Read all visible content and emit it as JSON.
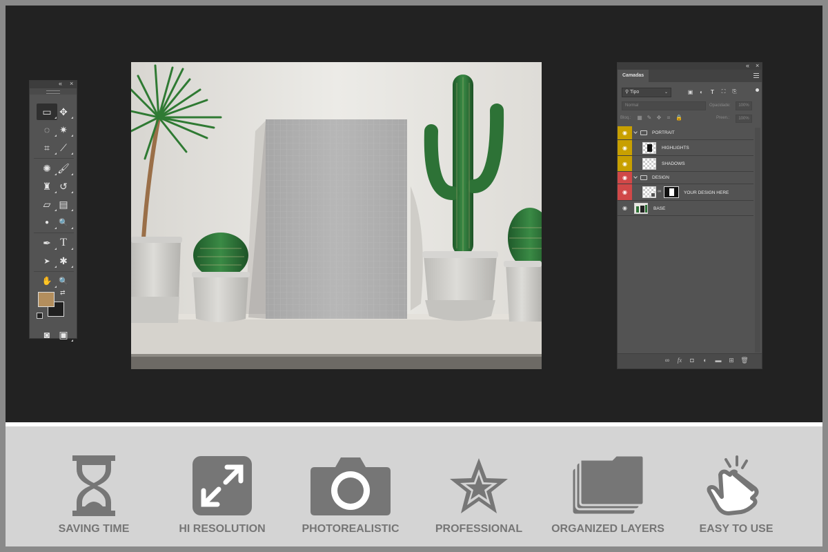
{
  "tools_panel": {
    "collapse_glyph": "«",
    "close_glyph": "×",
    "tools": [
      {
        "name": "rectangular-marquee-icon",
        "glyph": "▭"
      },
      {
        "name": "move-icon",
        "glyph": "✥"
      },
      {
        "name": "lasso-icon",
        "glyph": "◌"
      },
      {
        "name": "magic-wand-icon",
        "glyph": "✷"
      },
      {
        "name": "crop-icon",
        "glyph": "⌗"
      },
      {
        "name": "eyedropper-icon",
        "glyph": "⟋"
      },
      {
        "name": "spot-healing-icon",
        "glyph": "✺"
      },
      {
        "name": "brush-icon",
        "glyph": "🖌"
      },
      {
        "name": "clone-stamp-icon",
        "glyph": "♜"
      },
      {
        "name": "history-brush-icon",
        "glyph": "↺"
      },
      {
        "name": "eraser-icon",
        "glyph": "▱"
      },
      {
        "name": "gradient-icon",
        "glyph": "▤"
      },
      {
        "name": "blur-icon",
        "glyph": "●"
      },
      {
        "name": "dodge-icon",
        "glyph": "🔍"
      },
      {
        "name": "pen-icon",
        "glyph": "✒"
      },
      {
        "name": "type-icon",
        "glyph": "T"
      },
      {
        "name": "path-selection-icon",
        "glyph": "➤"
      },
      {
        "name": "shape-icon",
        "glyph": "✱"
      },
      {
        "name": "hand-icon",
        "glyph": "✋"
      },
      {
        "name": "zoom-icon",
        "glyph": "🔍"
      },
      {
        "name": "quick-mask-icon",
        "glyph": "◙"
      },
      {
        "name": "screen-mode-icon",
        "glyph": "▣"
      }
    ],
    "foreground_color": "#b38e5d",
    "background_color": "#1f1f1f"
  },
  "layers_panel": {
    "collapse_glyph": "«",
    "close_glyph": "×",
    "tab_label": "Camadas",
    "filter_label": "Tipo",
    "blend_mode": "Normal",
    "opacity_label": "Opacidade:",
    "opacity_value": "100%",
    "lock_label": "Bloq.:",
    "fill_label": "Preen.:",
    "fill_value": "100%",
    "layers": [
      {
        "name": "PORTRAIT",
        "kind": "group",
        "eye_color": "#c8a000"
      },
      {
        "name": "HIGHLIGHTS",
        "kind": "layer",
        "eye_color": "#c8a000"
      },
      {
        "name": "SHADOWS",
        "kind": "layer",
        "eye_color": "#c8a000"
      },
      {
        "name": "DESIGN",
        "kind": "group",
        "eye_color": "#d04848"
      },
      {
        "name": "YOUR DESIGN HERE",
        "kind": "smart-object",
        "eye_color": "#d04848"
      },
      {
        "name": "BASE",
        "kind": "image",
        "eye_color": "#535353"
      }
    ]
  },
  "features": [
    {
      "label": "SAVING TIME",
      "icon": "hourglass-icon"
    },
    {
      "label": "HI RESOLUTION",
      "icon": "expand-arrows-icon"
    },
    {
      "label": "PHOTOREALISTIC",
      "icon": "camera-icon"
    },
    {
      "label": "PROFESSIONAL",
      "icon": "star-icon"
    },
    {
      "label": "ORGANIZED LAYERS",
      "icon": "stacked-layers-icon"
    },
    {
      "label": "EASY TO USE",
      "icon": "tap-hand-icon"
    }
  ],
  "colors": {
    "workspace": "#222222",
    "panel": "#535353",
    "feature_bar": "#d4d4d4",
    "feature_icon": "#767676"
  }
}
